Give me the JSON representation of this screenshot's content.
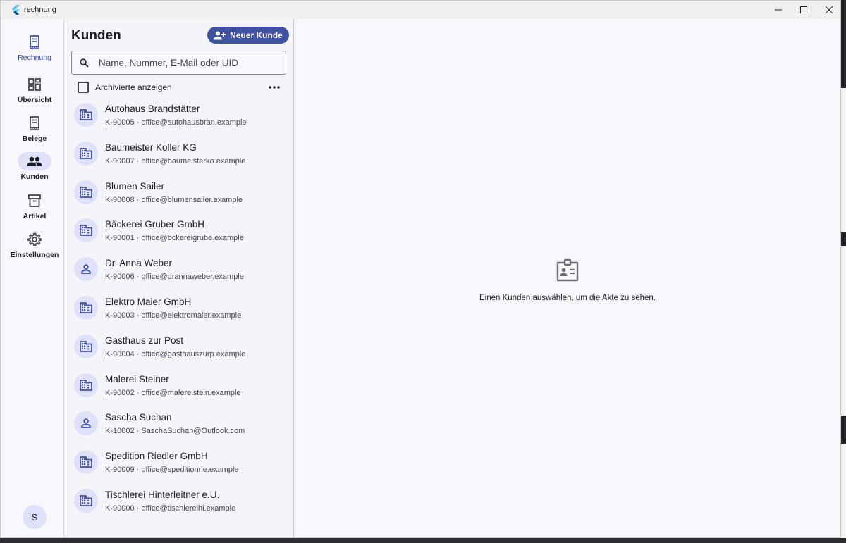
{
  "window": {
    "title": "rechnung",
    "controls": [
      "minimize",
      "maximize",
      "close"
    ]
  },
  "rail": {
    "items": [
      {
        "label": "Rechnung",
        "icon": "receipt-icon"
      },
      {
        "label": "Übersicht",
        "icon": "dashboard-icon"
      },
      {
        "label": "Belege",
        "icon": "receipt-long-icon"
      },
      {
        "label": "Kunden",
        "icon": "people-icon",
        "active": true
      },
      {
        "label": "Artikel",
        "icon": "archive-icon"
      },
      {
        "label": "Einstellungen",
        "icon": "gear-icon"
      }
    ],
    "avatar": "S"
  },
  "list": {
    "title": "Kunden",
    "new_button": "Neuer Kunde",
    "search_placeholder": "Name, Nummer, E-Mail oder UID",
    "archived_label": "Archivierte anzeigen",
    "customers": [
      {
        "name": "Autohaus Brandstätter",
        "number": "K-90005",
        "email": "office@autohausbran.example",
        "type": "business"
      },
      {
        "name": "Baumeister Koller KG",
        "number": "K-90007",
        "email": "office@baumeisterko.example",
        "type": "business"
      },
      {
        "name": "Blumen Sailer",
        "number": "K-90008",
        "email": "office@blumensailer.example",
        "type": "business"
      },
      {
        "name": "Bäckerei Gruber GmbH",
        "number": "K-90001",
        "email": "office@bckereigrube.example",
        "type": "business"
      },
      {
        "name": "Dr. Anna Weber",
        "number": "K-90006",
        "email": "office@drannaweber.example",
        "type": "person"
      },
      {
        "name": "Elektro Maier GmbH",
        "number": "K-90003",
        "email": "office@elektromaier.example",
        "type": "business"
      },
      {
        "name": "Gasthaus zur Post",
        "number": "K-90004",
        "email": "office@gasthauszurp.example",
        "type": "business"
      },
      {
        "name": "Malerei Steiner",
        "number": "K-90002",
        "email": "office@malereistein.example",
        "type": "business"
      },
      {
        "name": "Sascha Suchan",
        "number": "K-10002",
        "email": "SaschaSuchan@Outlook.com",
        "type": "person"
      },
      {
        "name": "Spedition Riedler GmbH",
        "number": "K-90009",
        "email": "office@speditionrie.example",
        "type": "business"
      },
      {
        "name": "Tischlerei Hinterleitner e.U.",
        "number": "K-90000",
        "email": "office@tischlereihi.example",
        "type": "business"
      }
    ]
  },
  "detail": {
    "empty_icon": "contact-card-icon",
    "empty_text": "Einen Kunden auswählen, um die Akte zu sehen."
  },
  "colors": {
    "accent": "#3f51a0",
    "accent_container": "#dee1f9",
    "surface": "#f8f8fc",
    "list_surface": "#f4f4f9",
    "text": "#1b1b21",
    "text_secondary": "#45464f"
  }
}
